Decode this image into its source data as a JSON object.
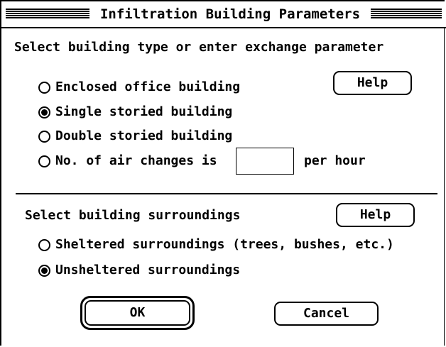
{
  "dialog": {
    "title": "Infiltration Building Parameters"
  },
  "building_type": {
    "heading": "Select building type or enter exchange parameter",
    "help_label": "Help",
    "options": [
      {
        "label": "Enclosed office building",
        "selected": false
      },
      {
        "label": "Single storied building",
        "selected": true
      },
      {
        "label": "Double storied building",
        "selected": false
      },
      {
        "label": "No. of air changes is",
        "selected": false
      }
    ],
    "air_changes_value": "",
    "air_changes_suffix": "per hour"
  },
  "surroundings": {
    "heading": "Select building surroundings",
    "help_label": "Help",
    "options": [
      {
        "label": "Sheltered surroundings (trees, bushes, etc.)",
        "selected": false
      },
      {
        "label": "Unsheltered surroundings",
        "selected": true
      }
    ]
  },
  "actions": {
    "ok_label": "OK",
    "cancel_label": "Cancel"
  }
}
